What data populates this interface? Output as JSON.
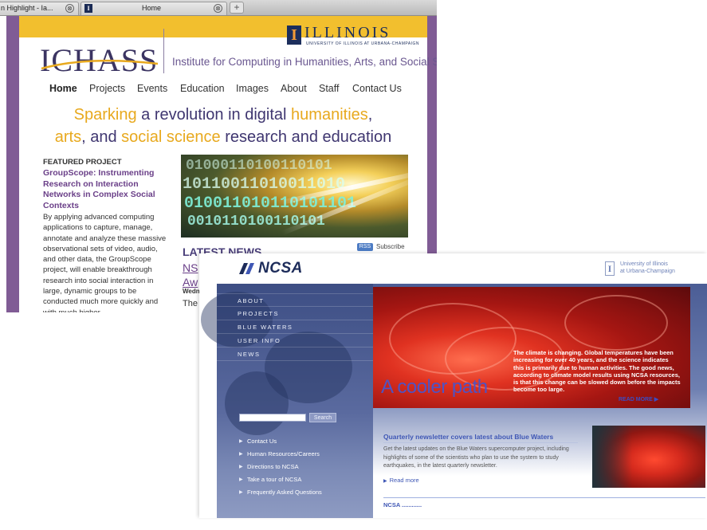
{
  "browser": {
    "tabs": [
      {
        "label": "n Highlight - Ia...",
        "close_glyph": "⊗"
      },
      {
        "label": "Home",
        "favicon_glyph": "I",
        "close_glyph": "⊗"
      }
    ],
    "new_tab_glyph": "+"
  },
  "ichass": {
    "colors": {
      "purple": "#805c95",
      "yellow": "#f2bf2e",
      "navy": "#3f3670",
      "accent": "#e8a91e"
    },
    "logo": "ICHASS",
    "illinois": {
      "glyph": "I",
      "word": "ILLINOIS",
      "subtitle": "UNIVERSITY OF ILLINOIS AT URBANA-CHAMPAIGN"
    },
    "institute_title": "Institute for Computing in Humanities, Arts, and Social Science",
    "nav": [
      "Home",
      "Projects",
      "Events",
      "Education",
      "Images",
      "About",
      "Staff",
      "Contact Us"
    ],
    "headline": {
      "line1": [
        "Sparking",
        " a revolution in digital ",
        "humanities",
        ","
      ],
      "line2": [
        "arts",
        ", and ",
        "social science",
        " research and education"
      ]
    },
    "featured": {
      "heading": "FEATURED PROJECT",
      "title": "GroupScope: Instrumenting Research on Interaction Networks in Complex Social Contexts",
      "body": "By applying advanced computing applications to capture, manage, annotate and analyze these massive observational sets of video, audio, and other data, the GroupScope project, will enable breakthrough research into social interaction in large, dynamic groups to be conducted much more quickly and with much higher"
    },
    "hero_binary": [
      "01000110100110101",
      "10110011010011010",
      "010011010110101101",
      "0010110100110101"
    ],
    "latest_news": {
      "heading": "LATEST NEWS",
      "rss_badge": "RSS",
      "rss_label": "Subscribe",
      "link_line1": "NS",
      "link_line2": "Aw",
      "date": "Wedn",
      "body_start": "The"
    }
  },
  "ncsa": {
    "colors": {
      "nav_blue": "#4b5d95",
      "link_blue": "#3f57b5",
      "hero_red": "#d52a1d"
    },
    "logo": "NCSA",
    "uiuc": {
      "glyph": "I",
      "line1": "University of Illinois",
      "line2": "at Urbana-Champaign"
    },
    "nav": [
      "ABOUT",
      "PROJECTS",
      "BLUE WATERS",
      "USER INFO",
      "NEWS"
    ],
    "hero": {
      "title": "A cooler path",
      "caption": "The climate is changing. Global temperatures have been increasing for over 40 years, and the science indicates this is primarily due to human activities. The good news, according to climate model results using NCSA resources, is that this change can be slowed down before the impacts become too large.",
      "read_more": "READ MORE ▶"
    },
    "search": {
      "placeholder": "",
      "button": "Search"
    },
    "links": [
      "Contact Us",
      "Human Resources/Careers",
      "Directions to NCSA",
      "Take a tour of NCSA",
      "Frequently Asked Questions"
    ],
    "link_arrow": "▶",
    "newsletter": {
      "title": "Quarterly newsletter covers latest about Blue Waters",
      "body": "Get the latest updates on the Blue Waters supercomputer project, including highlights of some of the scientists who plan to use the system to study earthquakes, in the latest quarterly newsletter.",
      "read_more": "Read more"
    },
    "bottom_partial": "NCSA ............"
  }
}
